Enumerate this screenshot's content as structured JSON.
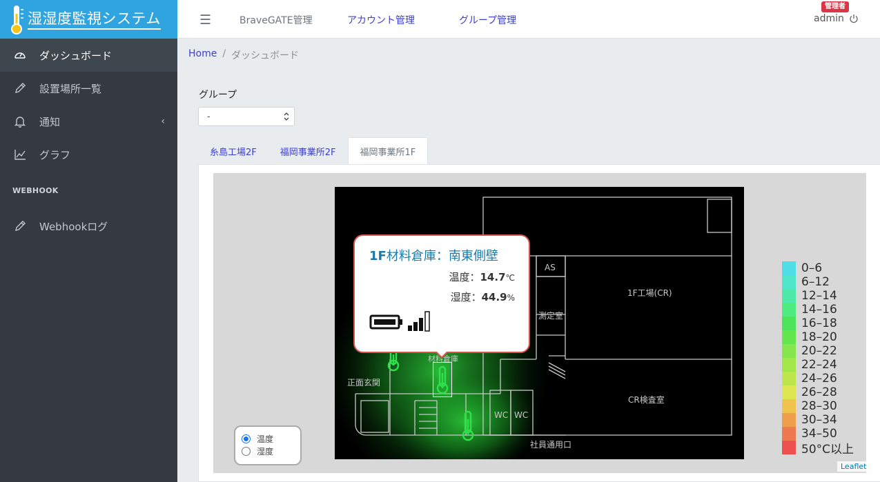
{
  "brand": {
    "title": "湿湿度監視システム",
    "icon": "thermometer-icon"
  },
  "sidebar": {
    "items": [
      {
        "label": "ダッシュボード",
        "icon": "dashboard-icon",
        "active": true
      },
      {
        "label": "設置場所一覧",
        "icon": "pencil-icon"
      },
      {
        "label": "通知",
        "icon": "bell-icon",
        "chevron": "‹"
      },
      {
        "label": "グラフ",
        "icon": "chart-line-icon"
      }
    ],
    "header": "WEBHOOK",
    "webhook_items": [
      {
        "label": "Webhookログ",
        "icon": "pencil-icon"
      }
    ]
  },
  "topbar": {
    "menu_icon": "☰",
    "links": [
      "BraveGATE管理",
      "アカウント管理",
      "グループ管理"
    ],
    "user": "admin",
    "badge": "管理者"
  },
  "breadcrumb": {
    "home": "Home",
    "separator": "/",
    "current": "ダッシュボード"
  },
  "group": {
    "label": "グループ",
    "selected": "-"
  },
  "tabs": [
    {
      "label": "糸島工場2F",
      "active": false
    },
    {
      "label": "福岡事業所2F",
      "active": false
    },
    {
      "label": "福岡事業所1F",
      "active": true
    }
  ],
  "floorplan": {
    "rooms": [
      "AS",
      "1F工場(CR)",
      "測定室",
      "材料倉庫",
      "正面玄関",
      "WC",
      "WC",
      "CR検査室",
      "社員通用口"
    ]
  },
  "popup": {
    "title": "1F材料倉庫：南東側壁",
    "title_bold": "1F",
    "temp_label": "温度：",
    "temp_value": "14.7",
    "temp_unit": "℃",
    "hum_label": "湿度：",
    "hum_value": "44.9",
    "hum_unit": "%",
    "battery_icon": "battery-full-icon",
    "signal_icon": "signal-bars-icon"
  },
  "legend": [
    {
      "label": "0–6",
      "color": "#4fdde8"
    },
    {
      "label": "6–12",
      "color": "#4ee6cb"
    },
    {
      "label": "12–14",
      "color": "#4ee8a8"
    },
    {
      "label": "14–16",
      "color": "#4deb80"
    },
    {
      "label": "16–18",
      "color": "#4ee45a"
    },
    {
      "label": "18–20",
      "color": "#63e64e"
    },
    {
      "label": "20–22",
      "color": "#86e64d"
    },
    {
      "label": "22–24",
      "color": "#a3e64c"
    },
    {
      "label": "24–26",
      "color": "#bde64b"
    },
    {
      "label": "26–28",
      "color": "#dfe750"
    },
    {
      "label": "28–30",
      "color": "#efc34d"
    },
    {
      "label": "30–34",
      "color": "#ef9f4c"
    },
    {
      "label": "34–50",
      "color": "#ef7a4f"
    },
    {
      "label": "50°C以上",
      "color": "#ee5050"
    }
  ],
  "mode": {
    "options": [
      "温度",
      "湿度"
    ],
    "selected": "温度"
  },
  "attribution": "Leaflet"
}
